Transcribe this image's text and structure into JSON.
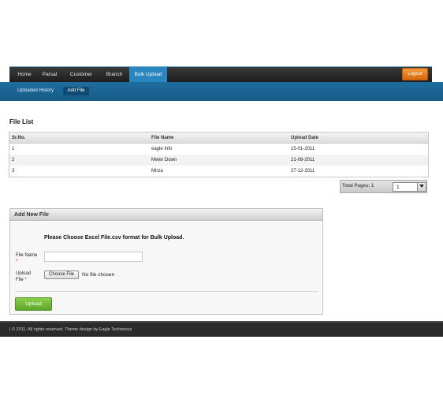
{
  "nav": {
    "items": [
      {
        "label": "Home"
      },
      {
        "label": "Parsal"
      },
      {
        "label": "Customer"
      },
      {
        "label": "Branch"
      },
      {
        "label": "Bulk Upload"
      }
    ],
    "active_index": 4,
    "logout_label": "Logout"
  },
  "subnav": {
    "items": [
      {
        "label": "Uploaded History"
      },
      {
        "label": "Add File"
      }
    ],
    "active_index": 1
  },
  "file_list": {
    "title": "File List",
    "columns": [
      "Sr.No.",
      "File Name",
      "Upload Date"
    ],
    "rows": [
      {
        "sr": "1",
        "name": "eagle Info",
        "date": "15-01-2011"
      },
      {
        "sr": "2",
        "name": "Meter Down",
        "date": "21-08-2011"
      },
      {
        "sr": "3",
        "name": "Mirza",
        "date": "27-12-2011"
      }
    ]
  },
  "pagination": {
    "label": "Total Pages: 1",
    "selected": "1"
  },
  "add_file": {
    "title": "Add New File",
    "instruction": "Please Choose Excel File.csv format for Bulk Upload.",
    "file_name_label": "File Name",
    "upload_file_label": "Upload File",
    "required_mark": "*",
    "file_name_value": "",
    "choose_button": "Choose File",
    "no_file_text": "No file chosen",
    "upload_button": "Upload"
  },
  "footer": {
    "text": "| © 2011. All rights reserved. Theme design by Eagle Technosys"
  },
  "colors": {
    "nav_active": "#2a86c0",
    "subnav_bg": "#1f6d9e",
    "logout": "#e67e22",
    "upload": "#6fb536"
  }
}
